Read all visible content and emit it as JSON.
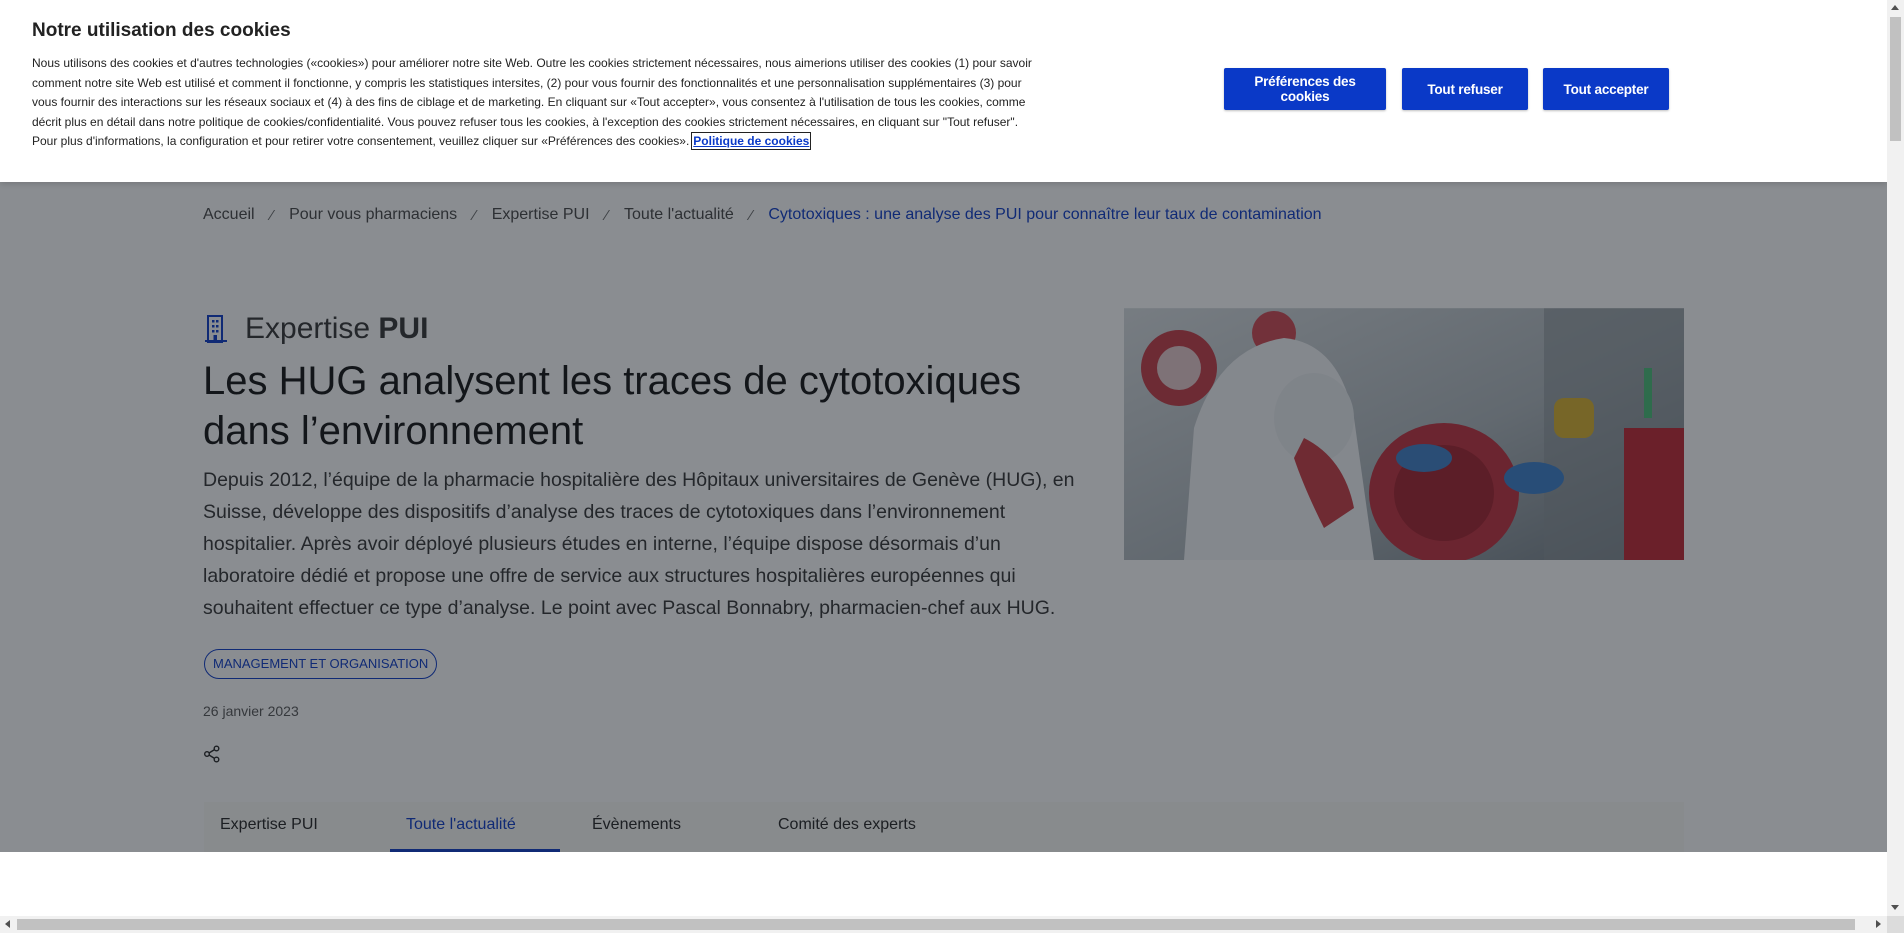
{
  "cookie_banner": {
    "title": "Notre utilisation des cookies",
    "body": "Nous utilisons des cookies et d'autres technologies («cookies») pour améliorer notre site Web. Outre les cookies strictement nécessaires, nous aimerions utiliser des cookies (1) pour savoir comment notre site Web est utilisé et comment il fonctionne, y compris les statistiques intersites, (2) pour vous fournir des fonctionnalités et une personnalisation supplémentaires (3) pour vous fournir des interactions sur les réseaux sociaux et (4) à des fins de ciblage et de marketing. En cliquant sur «Tout accepter», vous consentez à l'utilisation de tous les cookies, comme décrit plus en détail dans notre politique de cookies/confidentialité. Vous pouvez refuser tous les cookies, à l'exception des cookies strictement nécessaires, en cliquant sur \"Tout refuser\". Pour plus d'informations, la configuration et pour retirer votre consentement, veuillez cliquer sur «Préférences des cookies».",
    "policy_link": "Politique de cookies",
    "buttons": {
      "preferences": "Préférences des cookies",
      "reject_all": "Tout refuser",
      "accept_all": "Tout accepter"
    },
    "button_color": "#0a39c7"
  },
  "breadcrumb": {
    "items": [
      "Accueil",
      "Pour vous pharmaciens",
      "Expertise PUI",
      "Toute l'actualité"
    ],
    "current": "Cytotoxiques : une analyse des PUI pour connaître leur taux de contamination",
    "separator": "⁄"
  },
  "section": {
    "label_light": "Expertise",
    "label_bold": "PUI",
    "icon": "building-icon"
  },
  "article": {
    "title": "Les HUG analysent les traces de cytotoxiques dans l’environnement",
    "intro": "Depuis 2012, l’équipe de la pharmacie hospitalière des Hôpitaux universitaires de Genève (HUG), en Suisse, développe des dispositifs d’analyse des traces de cytotoxiques dans l’environnement hospitalier. Après avoir déployé plusieurs études en interne, l’équipe dispose désormais d’un laboratoire dédié et propose une offre de service aux structures hospitalières européennes qui souhaitent effectuer ce type d’analyse. Le point avec Pascal Bonnabry, pharmacien-chef aux HUG.",
    "tag": "MANAGEMENT ET ORGANISATION",
    "date": "26 janvier 2023",
    "share_icon": "share-icon"
  },
  "tabs": [
    {
      "label": "Expertise PUI",
      "active": false
    },
    {
      "label": "Toute l'actualité",
      "active": true
    },
    {
      "label": "Évènements",
      "active": false
    },
    {
      "label": "Comité des experts",
      "active": false
    }
  ],
  "colors": {
    "accent": "#0a39c7",
    "overlay": "rgba(22,28,36,0.5)"
  }
}
